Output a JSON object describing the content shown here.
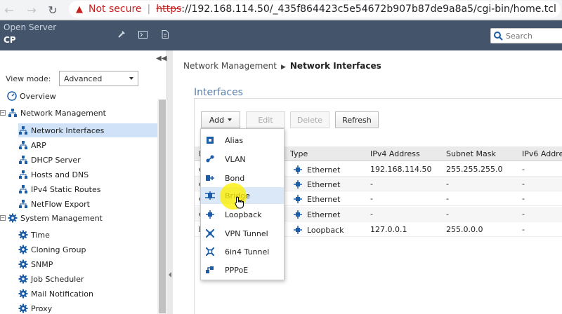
{
  "browser": {
    "security_label": "Not secure",
    "url_scheme": "https",
    "url_rest": "://192.168.114.50/_435f864423c5e54672b907b87de9a8a5/cgi-bin/home.tcl"
  },
  "header": {
    "title": "Open Server",
    "subtitle": "CP",
    "search_placeholder": "Search",
    "bg_color": "#44546a"
  },
  "sidebar": {
    "view_mode_label": "View mode:",
    "view_mode_value": "Advanced",
    "items": [
      {
        "label": "Overview",
        "icon": "overview-icon"
      },
      {
        "label": "Network Management",
        "icon": "network-tree-icon"
      },
      {
        "label": "Network Interfaces",
        "icon": "network-tree-icon"
      },
      {
        "label": "ARP",
        "icon": "network-tree-icon"
      },
      {
        "label": "DHCP Server",
        "icon": "network-tree-icon"
      },
      {
        "label": "Hosts and DNS",
        "icon": "network-tree-icon"
      },
      {
        "label": "IPv4 Static Routes",
        "icon": "network-tree-icon"
      },
      {
        "label": "NetFlow Export",
        "icon": "network-tree-icon"
      },
      {
        "label": "System Management",
        "icon": "gear-icon"
      },
      {
        "label": "Time",
        "icon": "gear-icon"
      },
      {
        "label": "Cloning Group",
        "icon": "gear-icon"
      },
      {
        "label": "SNMP",
        "icon": "gear-icon"
      },
      {
        "label": "Job Scheduler",
        "icon": "gear-icon"
      },
      {
        "label": "Mail Notification",
        "icon": "gear-icon"
      },
      {
        "label": "Proxy",
        "icon": "gear-icon"
      }
    ]
  },
  "breadcrumb": {
    "parent": "Network Management",
    "current": "Network Interfaces"
  },
  "section_title": "Interfaces",
  "toolbar": {
    "add": "Add",
    "edit": "Edit",
    "delete": "Delete",
    "refresh": "Refresh"
  },
  "add_menu": [
    {
      "label": "Alias",
      "icon": "alias-icon"
    },
    {
      "label": "VLAN",
      "icon": "vlan-icon"
    },
    {
      "label": "Bond",
      "icon": "bond-icon"
    },
    {
      "label": "Bridge",
      "icon": "bridge-icon"
    },
    {
      "label": "Loopback",
      "icon": "loopback-icon"
    },
    {
      "label": "VPN Tunnel",
      "icon": "vpn-tunnel-icon"
    },
    {
      "label": "6in4 Tunnel",
      "icon": "tunnel-6in4-icon"
    },
    {
      "label": "PPPoE",
      "icon": "pppoe-icon"
    }
  ],
  "table": {
    "columns": [
      "N",
      "Type",
      "IPv4 Address",
      "Subnet Mask",
      "IPv6 Addres"
    ],
    "rows": [
      {
        "name": "e",
        "type": "Ethernet",
        "ipv4": "192.168.114.50",
        "mask": "255.255.255.0",
        "ipv6": "-"
      },
      {
        "name": "e",
        "type": "Ethernet",
        "ipv4": "-",
        "mask": "-",
        "ipv6": "-"
      },
      {
        "name": "e",
        "type": "Ethernet",
        "ipv4": "-",
        "mask": "-",
        "ipv6": "-"
      },
      {
        "name": "e",
        "type": "Ethernet",
        "ipv4": "-",
        "mask": "-",
        "ipv6": "-"
      },
      {
        "name": "l",
        "type": "Loopback",
        "ipv4": "127.0.0.1",
        "mask": "255.0.0.0",
        "ipv6": "-"
      }
    ]
  },
  "colors": {
    "accent": "#1a5ca8",
    "selected": "#cfe2f8",
    "title": "#5b7fa8"
  }
}
